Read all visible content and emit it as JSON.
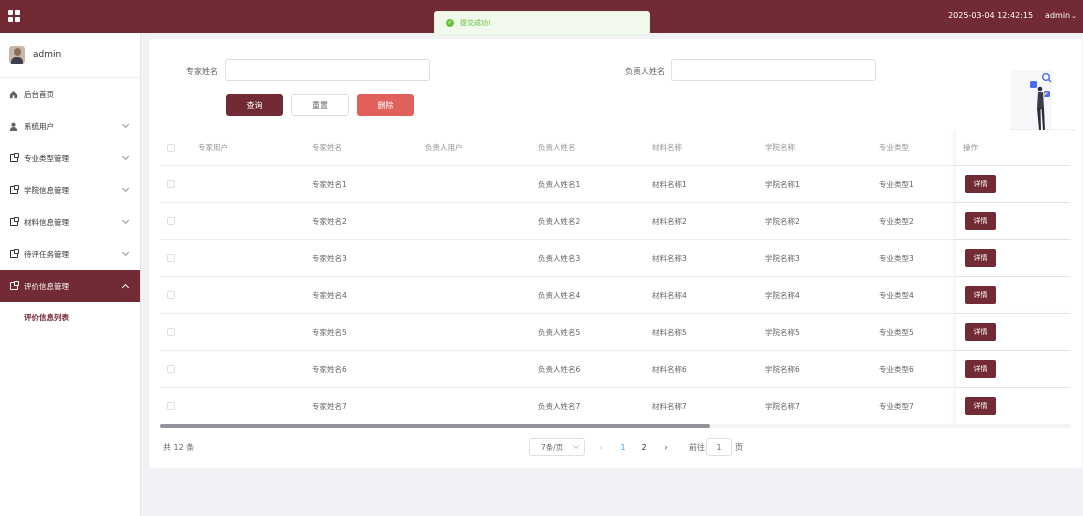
{
  "header": {
    "datetime": "2025-03-04 12:42:15",
    "user": "admin",
    "user_caret": "⌄",
    "bg_color": "#722b35"
  },
  "toast": {
    "message": "提交成功!",
    "icon": "check-circle-icon",
    "color": "#67c23a"
  },
  "sidebar": {
    "profile_name": "admin",
    "items": [
      {
        "label": "后台首页",
        "icon": "home-icon"
      },
      {
        "label": "系统用户",
        "icon": "user-icon"
      },
      {
        "label": "专业类型管理",
        "icon": "doc-icon"
      },
      {
        "label": "学院信息管理",
        "icon": "doc-icon"
      },
      {
        "label": "材料信息管理",
        "icon": "doc-icon"
      },
      {
        "label": "待评任务管理",
        "icon": "doc-icon"
      },
      {
        "label": "评价信息管理",
        "icon": "doc-icon"
      }
    ],
    "sub_item": "评价信息列表"
  },
  "search": {
    "expert_label": "专家姓名",
    "manager_label": "负责人姓名",
    "expert_value": "",
    "manager_value": ""
  },
  "buttons": {
    "query": "查询",
    "reset": "重置",
    "delete": "删除"
  },
  "table": {
    "headers": [
      "专家用户",
      "专家姓名",
      "负责人用户",
      "负责人姓名",
      "材料名称",
      "学院名称",
      "专业类型",
      "操作"
    ],
    "detail_label": "详情",
    "rows": [
      {
        "expert_user": "",
        "expert_name": "专家姓名1",
        "manager_user": "",
        "manager_name": "负责人姓名1",
        "material": "材料名称1",
        "college": "学院名称1",
        "major": "专业类型1"
      },
      {
        "expert_user": "",
        "expert_name": "专家姓名2",
        "manager_user": "",
        "manager_name": "负责人姓名2",
        "material": "材料名称2",
        "college": "学院名称2",
        "major": "专业类型2"
      },
      {
        "expert_user": "",
        "expert_name": "专家姓名3",
        "manager_user": "",
        "manager_name": "负责人姓名3",
        "material": "材料名称3",
        "college": "学院名称3",
        "major": "专业类型3"
      },
      {
        "expert_user": "",
        "expert_name": "专家姓名4",
        "manager_user": "",
        "manager_name": "负责人姓名4",
        "material": "材料名称4",
        "college": "学院名称4",
        "major": "专业类型4"
      },
      {
        "expert_user": "",
        "expert_name": "专家姓名5",
        "manager_user": "",
        "manager_name": "负责人姓名5",
        "material": "材料名称5",
        "college": "学院名称5",
        "major": "专业类型5"
      },
      {
        "expert_user": "",
        "expert_name": "专家姓名6",
        "manager_user": "",
        "manager_name": "负责人姓名6",
        "material": "材料名称6",
        "college": "学院名称6",
        "major": "专业类型6"
      },
      {
        "expert_user": "",
        "expert_name": "专家姓名7",
        "manager_user": "",
        "manager_name": "负责人姓名7",
        "material": "材料名称7",
        "college": "学院名称7",
        "major": "专业类型7"
      }
    ]
  },
  "pagination": {
    "total": "共 12 条",
    "page_size": "7条/页",
    "pages": [
      "1",
      "2"
    ],
    "current_page": "1",
    "prev": "‹",
    "next": "›",
    "goto_label": "前往",
    "goto_value": "1",
    "page_suffix": "页"
  }
}
